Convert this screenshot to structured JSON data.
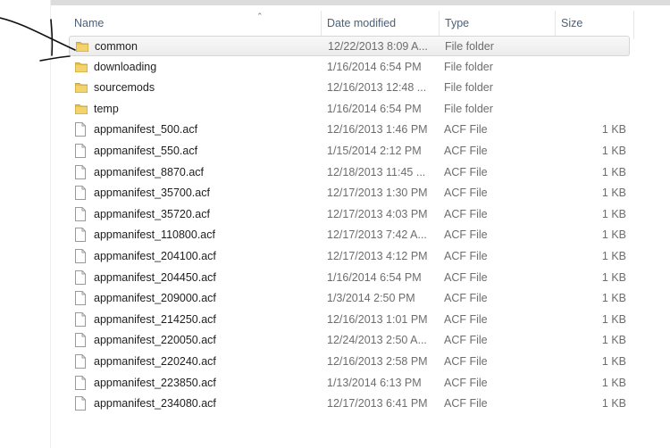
{
  "columns": {
    "name": "Name",
    "date_modified": "Date modified",
    "type": "Type",
    "size": "Size"
  },
  "files": [
    {
      "name": "common",
      "date": "12/22/2013 8:09 A...",
      "type": "File folder",
      "size": "",
      "icon": "folder-icon",
      "selected": true
    },
    {
      "name": "downloading",
      "date": "1/16/2014 6:54 PM",
      "type": "File folder",
      "size": "",
      "icon": "folder-icon"
    },
    {
      "name": "sourcemods",
      "date": "12/16/2013 12:48 ...",
      "type": "File folder",
      "size": "",
      "icon": "folder-icon"
    },
    {
      "name": "temp",
      "date": "1/16/2014 6:54 PM",
      "type": "File folder",
      "size": "",
      "icon": "folder-icon"
    },
    {
      "name": "appmanifest_500.acf",
      "date": "12/16/2013 1:46 PM",
      "type": "ACF File",
      "size": "1 KB",
      "icon": "file-icon"
    },
    {
      "name": "appmanifest_550.acf",
      "date": "1/15/2014 2:12 PM",
      "type": "ACF File",
      "size": "1 KB",
      "icon": "file-icon"
    },
    {
      "name": "appmanifest_8870.acf",
      "date": "12/18/2013 11:45 ...",
      "type": "ACF File",
      "size": "1 KB",
      "icon": "file-icon"
    },
    {
      "name": "appmanifest_35700.acf",
      "date": "12/17/2013 1:30 PM",
      "type": "ACF File",
      "size": "1 KB",
      "icon": "file-icon"
    },
    {
      "name": "appmanifest_35720.acf",
      "date": "12/17/2013 4:03 PM",
      "type": "ACF File",
      "size": "1 KB",
      "icon": "file-icon"
    },
    {
      "name": "appmanifest_110800.acf",
      "date": "12/17/2013 7:42 A...",
      "type": "ACF File",
      "size": "1 KB",
      "icon": "file-icon"
    },
    {
      "name": "appmanifest_204100.acf",
      "date": "12/17/2013 4:12 PM",
      "type": "ACF File",
      "size": "1 KB",
      "icon": "file-icon"
    },
    {
      "name": "appmanifest_204450.acf",
      "date": "1/16/2014 6:54 PM",
      "type": "ACF File",
      "size": "1 KB",
      "icon": "file-icon"
    },
    {
      "name": "appmanifest_209000.acf",
      "date": "1/3/2014 2:50 PM",
      "type": "ACF File",
      "size": "1 KB",
      "icon": "file-icon"
    },
    {
      "name": "appmanifest_214250.acf",
      "date": "12/16/2013 1:01 PM",
      "type": "ACF File",
      "size": "1 KB",
      "icon": "file-icon"
    },
    {
      "name": "appmanifest_220050.acf",
      "date": "12/24/2013 2:50 A...",
      "type": "ACF File",
      "size": "1 KB",
      "icon": "file-icon"
    },
    {
      "name": "appmanifest_220240.acf",
      "date": "12/16/2013 2:58 PM",
      "type": "ACF File",
      "size": "1 KB",
      "icon": "file-icon"
    },
    {
      "name": "appmanifest_223850.acf",
      "date": "1/13/2014 6:13 PM",
      "type": "ACF File",
      "size": "1 KB",
      "icon": "file-icon"
    },
    {
      "name": "appmanifest_234080.acf",
      "date": "12/17/2013 6:41 PM",
      "type": "ACF File",
      "size": "1 KB",
      "icon": "file-icon"
    }
  ],
  "colors": {
    "header_text": "#4c607a",
    "folder": "#e8c04a",
    "selection": "#ececec"
  }
}
